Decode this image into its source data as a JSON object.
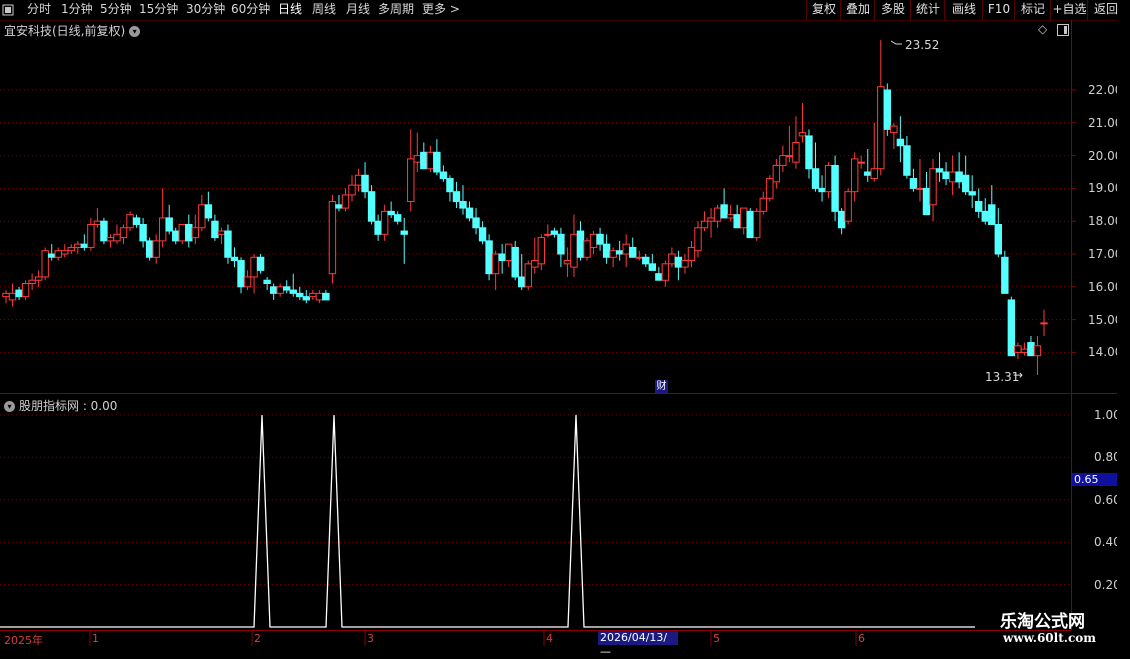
{
  "toolbar": {
    "left_items": [
      "分时",
      "1分钟",
      "5分钟",
      "15分钟",
      "30分钟",
      "60分钟",
      "日线",
      "周线",
      "月线",
      "多周期",
      "更多 >"
    ],
    "active_item": "日线",
    "right_items": [
      "复权",
      "叠加",
      "多股",
      "统计",
      "画线",
      "F10",
      "标记",
      "+自选",
      "返回"
    ]
  },
  "chart": {
    "title": "宜安科技(日线,前复权)",
    "high_label": "23.52",
    "low_label": "13.31",
    "finance_marker": "财",
    "price_axis": [
      "22.00",
      "21.00",
      "20.00",
      "19.00",
      "18.00",
      "17.00",
      "16.00",
      "15.00",
      "14.00"
    ]
  },
  "indicator": {
    "title": "股朋指标网 : 0.00",
    "axis": [
      "1.00",
      "0.80",
      "0.60",
      "0.40",
      "0.20"
    ],
    "cursor_value": "0.65"
  },
  "timeline": {
    "year": "2025年",
    "months": [
      "1",
      "2",
      "3",
      "4",
      "5",
      "6"
    ],
    "cursor_date": "2026/04/13/—"
  },
  "watermark": {
    "line1": "乐淘公式网",
    "line2": "www.60lt.com"
  },
  "colors": {
    "up": "#ff3b3b",
    "down": "#54ffff",
    "grid": "#7a0000",
    "background": "#000000"
  },
  "chart_data": {
    "type": "candlestick",
    "candles": [
      [
        15.7,
        15.9,
        15.5,
        15.8
      ],
      [
        15.6,
        16.1,
        15.4,
        15.8
      ],
      [
        15.9,
        16.0,
        15.6,
        15.7
      ],
      [
        15.7,
        16.2,
        15.6,
        16.1
      ],
      [
        16.1,
        16.4,
        15.9,
        16.2
      ],
      [
        16.2,
        16.5,
        16.0,
        16.3
      ],
      [
        16.3,
        17.2,
        16.2,
        17.1
      ],
      [
        17.0,
        17.3,
        16.8,
        16.9
      ],
      [
        16.9,
        17.2,
        16.8,
        17.1
      ],
      [
        17.0,
        17.3,
        16.9,
        17.1
      ],
      [
        17.1,
        17.3,
        17.0,
        17.2
      ],
      [
        17.2,
        17.4,
        17.0,
        17.3
      ],
      [
        17.3,
        17.6,
        17.1,
        17.2
      ],
      [
        17.2,
        18.1,
        17.1,
        17.9
      ],
      [
        17.9,
        18.4,
        17.8,
        18.0
      ],
      [
        18.0,
        18.1,
        17.3,
        17.4
      ],
      [
        17.4,
        17.6,
        17.2,
        17.5
      ],
      [
        17.4,
        17.9,
        17.3,
        17.6
      ],
      [
        17.5,
        17.9,
        17.3,
        17.8
      ],
      [
        17.8,
        18.3,
        17.7,
        18.2
      ],
      [
        18.1,
        18.2,
        17.8,
        17.9
      ],
      [
        17.9,
        18.1,
        17.2,
        17.4
      ],
      [
        17.4,
        17.5,
        16.8,
        16.9
      ],
      [
        16.9,
        17.6,
        16.7,
        17.4
      ],
      [
        17.4,
        19.0,
        17.2,
        18.1
      ],
      [
        18.1,
        18.5,
        17.6,
        17.7
      ],
      [
        17.7,
        17.8,
        17.3,
        17.4
      ],
      [
        17.4,
        17.9,
        17.3,
        17.9
      ],
      [
        17.9,
        18.2,
        17.2,
        17.4
      ],
      [
        17.5,
        18.2,
        17.3,
        17.8
      ],
      [
        17.8,
        18.8,
        17.7,
        18.5
      ],
      [
        18.5,
        18.9,
        18.0,
        18.1
      ],
      [
        18.0,
        18.2,
        17.4,
        17.5
      ],
      [
        17.6,
        17.8,
        17.3,
        17.7
      ],
      [
        17.7,
        17.9,
        16.7,
        16.9
      ],
      [
        16.9,
        17.2,
        16.6,
        16.8
      ],
      [
        16.8,
        16.9,
        15.8,
        16.0
      ],
      [
        16.0,
        16.5,
        15.9,
        16.3
      ],
      [
        16.3,
        17.0,
        15.8,
        16.9
      ],
      [
        16.9,
        17.0,
        16.4,
        16.5
      ],
      [
        16.2,
        16.3,
        15.9,
        16.1
      ],
      [
        16.0,
        16.1,
        15.6,
        15.8
      ],
      [
        15.8,
        16.1,
        15.7,
        16.0
      ],
      [
        16.0,
        16.2,
        15.8,
        15.9
      ],
      [
        15.9,
        16.4,
        15.7,
        15.8
      ],
      [
        15.8,
        16.0,
        15.6,
        15.7
      ],
      [
        15.7,
        15.9,
        15.5,
        15.6
      ],
      [
        15.7,
        15.9,
        15.6,
        15.8
      ],
      [
        15.6,
        15.9,
        15.5,
        15.8
      ],
      [
        15.8,
        15.9,
        15.6,
        15.6
      ],
      [
        16.4,
        18.8,
        16.1,
        18.6
      ],
      [
        18.5,
        18.8,
        18.3,
        18.4
      ],
      [
        18.4,
        19.0,
        18.3,
        18.8
      ],
      [
        18.8,
        19.4,
        18.6,
        19.1
      ],
      [
        19.1,
        19.6,
        18.9,
        19.4
      ],
      [
        19.4,
        19.8,
        18.7,
        18.9
      ],
      [
        18.9,
        19.1,
        17.9,
        18.0
      ],
      [
        18.0,
        18.2,
        17.4,
        17.6
      ],
      [
        17.6,
        18.5,
        17.4,
        18.3
      ],
      [
        18.3,
        18.6,
        18.1,
        18.2
      ],
      [
        18.2,
        18.3,
        17.9,
        18.0
      ],
      [
        17.7,
        18.1,
        16.7,
        17.6
      ],
      [
        18.6,
        20.8,
        18.3,
        19.9
      ],
      [
        19.8,
        20.7,
        19.5,
        20.0
      ],
      [
        20.1,
        20.4,
        19.7,
        19.6
      ],
      [
        19.6,
        20.3,
        19.5,
        20.1
      ],
      [
        20.1,
        20.5,
        19.4,
        19.5
      ],
      [
        19.5,
        19.7,
        19.2,
        19.3
      ],
      [
        19.3,
        19.4,
        18.6,
        18.9
      ],
      [
        18.9,
        19.2,
        18.4,
        18.6
      ],
      [
        18.6,
        19.1,
        18.2,
        18.4
      ],
      [
        18.4,
        18.6,
        18.0,
        18.1
      ],
      [
        18.1,
        18.4,
        17.6,
        17.8
      ],
      [
        17.8,
        18.0,
        17.3,
        17.4
      ],
      [
        17.4,
        17.6,
        16.2,
        16.4
      ],
      [
        16.4,
        17.1,
        15.9,
        17.0
      ],
      [
        17.0,
        17.3,
        16.4,
        16.8
      ],
      [
        16.8,
        17.3,
        16.6,
        17.3
      ],
      [
        17.2,
        17.4,
        16.2,
        16.3
      ],
      [
        16.3,
        17.0,
        15.9,
        16.0
      ],
      [
        16.0,
        16.8,
        15.9,
        16.7
      ],
      [
        16.6,
        17.5,
        16.4,
        16.8
      ],
      [
        16.7,
        17.6,
        16.5,
        17.5
      ],
      [
        17.6,
        17.9,
        17.5,
        17.6
      ],
      [
        17.7,
        17.8,
        17.5,
        17.6
      ],
      [
        17.6,
        17.8,
        16.6,
        17.0
      ],
      [
        16.7,
        17.2,
        16.3,
        16.8
      ],
      [
        16.6,
        18.2,
        16.3,
        17.6
      ],
      [
        17.7,
        18.0,
        16.8,
        16.9
      ],
      [
        16.9,
        17.5,
        16.8,
        17.4
      ],
      [
        17.2,
        17.7,
        17.0,
        17.6
      ],
      [
        17.6,
        17.8,
        17.1,
        17.3
      ],
      [
        17.3,
        17.6,
        16.7,
        16.9
      ],
      [
        16.9,
        17.2,
        16.6,
        17.1
      ],
      [
        17.1,
        17.4,
        16.8,
        17.0
      ],
      [
        17.0,
        17.6,
        16.6,
        17.3
      ],
      [
        17.2,
        17.5,
        16.9,
        16.9
      ],
      [
        16.9,
        17.1,
        16.8,
        16.9
      ],
      [
        16.9,
        17.0,
        16.6,
        16.7
      ],
      [
        16.7,
        17.0,
        16.5,
        16.5
      ],
      [
        16.4,
        16.6,
        16.2,
        16.2
      ],
      [
        16.2,
        16.8,
        16.0,
        16.7
      ],
      [
        16.7,
        17.2,
        16.6,
        17.0
      ],
      [
        16.9,
        17.1,
        16.2,
        16.6
      ],
      [
        16.6,
        17.0,
        16.4,
        16.8
      ],
      [
        16.8,
        17.4,
        16.6,
        17.2
      ],
      [
        17.1,
        18.0,
        16.9,
        17.8
      ],
      [
        17.8,
        18.3,
        17.7,
        18.0
      ],
      [
        18.0,
        18.4,
        17.5,
        18.1
      ],
      [
        18.0,
        18.5,
        17.8,
        18.4
      ],
      [
        18.5,
        19.0,
        18.1,
        18.1
      ],
      [
        18.1,
        18.5,
        18.0,
        18.2
      ],
      [
        18.2,
        18.5,
        17.9,
        17.8
      ],
      [
        17.8,
        18.4,
        17.6,
        18.4
      ],
      [
        18.3,
        18.4,
        17.5,
        17.5
      ],
      [
        17.5,
        18.4,
        17.4,
        18.3
      ],
      [
        18.3,
        18.9,
        18.2,
        18.7
      ],
      [
        18.7,
        19.4,
        18.6,
        19.3
      ],
      [
        19.2,
        19.9,
        19.0,
        19.7
      ],
      [
        19.7,
        20.3,
        19.5,
        20.0
      ],
      [
        20.0,
        20.9,
        19.8,
        20.0
      ],
      [
        19.8,
        21.2,
        19.6,
        20.4
      ],
      [
        20.6,
        21.6,
        20.4,
        20.7
      ],
      [
        20.6,
        20.8,
        19.3,
        19.6
      ],
      [
        19.6,
        20.4,
        18.9,
        19.0
      ],
      [
        19.0,
        19.4,
        18.6,
        18.9
      ],
      [
        18.9,
        19.8,
        18.7,
        19.7
      ],
      [
        19.7,
        20.0,
        18.0,
        18.3
      ],
      [
        18.3,
        18.4,
        17.6,
        17.8
      ],
      [
        18.0,
        19.0,
        17.9,
        18.9
      ],
      [
        18.9,
        20.1,
        18.6,
        19.9
      ],
      [
        19.8,
        20.0,
        19.6,
        19.8
      ],
      [
        19.5,
        20.2,
        19.2,
        19.4
      ],
      [
        19.3,
        21.0,
        19.2,
        19.6
      ],
      [
        19.6,
        23.52,
        19.4,
        22.1
      ],
      [
        22.0,
        22.2,
        20.6,
        20.8
      ],
      [
        20.7,
        21.0,
        20.2,
        20.9
      ],
      [
        20.5,
        21.2,
        19.8,
        20.3
      ],
      [
        20.3,
        20.6,
        19.3,
        19.4
      ],
      [
        19.3,
        19.6,
        18.9,
        19.0
      ],
      [
        19.0,
        19.9,
        18.6,
        19.0
      ],
      [
        19.0,
        19.5,
        18.2,
        18.2
      ],
      [
        18.5,
        19.9,
        18.0,
        19.6
      ],
      [
        19.6,
        20.1,
        19.2,
        19.5
      ],
      [
        19.5,
        19.8,
        19.1,
        19.3
      ],
      [
        19.2,
        20.0,
        18.8,
        19.5
      ],
      [
        19.5,
        20.1,
        19.0,
        19.2
      ],
      [
        19.4,
        20.0,
        18.8,
        18.9
      ],
      [
        18.9,
        19.4,
        18.4,
        18.8
      ],
      [
        18.6,
        19.0,
        18.1,
        18.3
      ],
      [
        18.3,
        18.7,
        17.9,
        18.0
      ],
      [
        18.5,
        19.1,
        17.9,
        17.9
      ],
      [
        17.9,
        18.4,
        16.9,
        17.0
      ],
      [
        16.9,
        17.1,
        15.8,
        15.8
      ],
      [
        15.6,
        15.7,
        13.9,
        13.9
      ],
      [
        14.0,
        14.3,
        13.8,
        14.2
      ],
      [
        14.0,
        14.3,
        13.9,
        14.1
      ],
      [
        14.3,
        14.5,
        14.0,
        13.9
      ],
      [
        13.9,
        14.5,
        13.31,
        14.2
      ],
      [
        14.9,
        15.3,
        14.5,
        14.9
      ]
    ],
    "indicator": {
      "type": "line",
      "peaks_at_index": [
        33,
        43,
        74
      ],
      "ylim": [
        0,
        1.0
      ],
      "values_at_peaks": [
        1.0,
        1.0,
        1.0
      ]
    },
    "ylim": [
      13.2,
      23.8
    ]
  }
}
